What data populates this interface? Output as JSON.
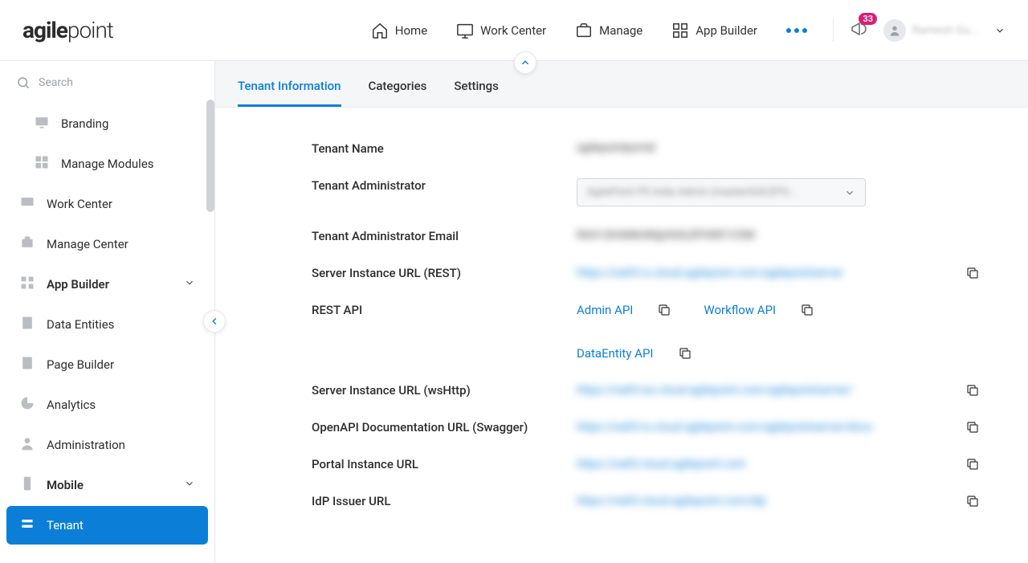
{
  "header": {
    "logo_bold": "agile",
    "logo_light": "point",
    "nav": [
      {
        "label": "Home",
        "name": "home"
      },
      {
        "label": "Work Center",
        "name": "work-center"
      },
      {
        "label": "Manage",
        "name": "manage"
      },
      {
        "label": "App Builder",
        "name": "app-builder"
      }
    ],
    "notif_count": "33",
    "user_name": "Ramesh Gu..."
  },
  "search": {
    "placeholder": "Search"
  },
  "sidebar": {
    "items": [
      {
        "label": "Branding",
        "indent": true
      },
      {
        "label": "Manage Modules",
        "indent": true
      },
      {
        "label": "Work Center"
      },
      {
        "label": "Manage Center"
      },
      {
        "label": "App Builder",
        "heavy": true,
        "expand": true
      },
      {
        "label": "Data Entities"
      },
      {
        "label": "Page Builder"
      },
      {
        "label": "Analytics"
      },
      {
        "label": "Administration"
      },
      {
        "label": "Mobile",
        "heavy": true,
        "expand": true
      },
      {
        "label": "Tenant",
        "active": true
      }
    ]
  },
  "tabs": [
    {
      "label": "Tenant Information",
      "active": true
    },
    {
      "label": "Categories"
    },
    {
      "label": "Settings"
    }
  ],
  "fields": {
    "tenant_name_label": "Tenant Name",
    "tenant_name_value": "agilepointportal",
    "tenant_admin_label": "Tenant Administrator",
    "tenant_admin_value": "AgilePoint PS India Admin (masterAGILEPO...",
    "tenant_admin_email_label": "Tenant Administrator Email",
    "tenant_admin_email_value": "RAVI.SHANKAR@AGILEPOINT.COM",
    "rest_url_label": "Server Instance URL (REST)",
    "rest_url_value": "https://na03-rs.cloud.agilepoint.com/agilepointserver",
    "rest_api_label": "REST API",
    "api_admin": "Admin API",
    "api_workflow": "Workflow API",
    "api_dataentity": "DataEntity API",
    "wshttp_label": "Server Instance URL (wsHttp)",
    "wshttp_value": "https://na03-ws.cloud.agilepoint.com/agilepointserver/",
    "swagger_label": "OpenAPI Documentation URL (Swagger)",
    "swagger_value": "https://na03-rs.cloud.agilepoint.com/agilepointserver/docs",
    "portal_label": "Portal Instance URL",
    "portal_value": "https://na03.cloud.agilepoint.com",
    "idp_label": "IdP Issuer URL",
    "idp_value": "https://na03.cloud.agilepoint.com/idp"
  }
}
